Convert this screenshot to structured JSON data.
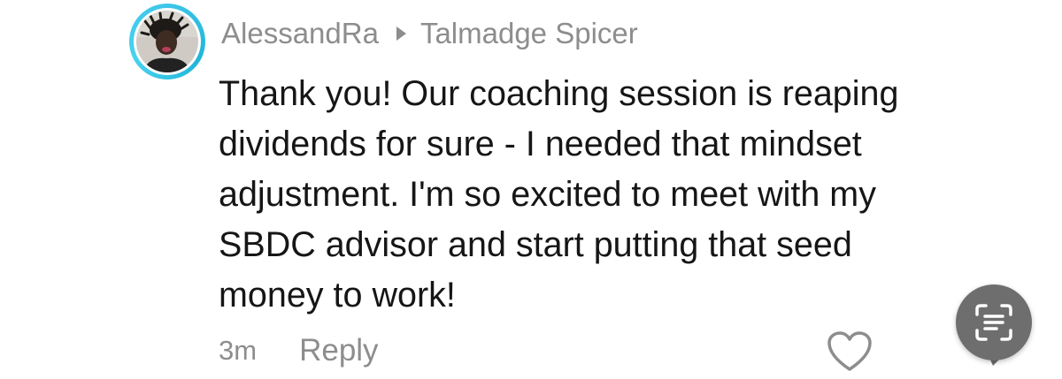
{
  "comment": {
    "author": "AlessandRa",
    "reply_to": "Talmadge Spicer",
    "lines": [
      "Thank you! Our coaching session is reaping",
      "dividends for sure - I needed that mindset",
      "adjustment. I'm so excited to meet with my",
      "SBDC advisor and start putting that seed",
      "money to work!"
    ],
    "timestamp": "3m",
    "reply_label": "Reply"
  },
  "icons": {
    "reply_arrow": "triangle-right-icon",
    "like": "heart-outline-icon",
    "scan": "text-scan-icon"
  },
  "colors": {
    "avatar_ring": "#3ec6e8",
    "meta_text": "#8d8d8d",
    "body_text": "#161616",
    "scan_button": "#6e6e6e"
  }
}
